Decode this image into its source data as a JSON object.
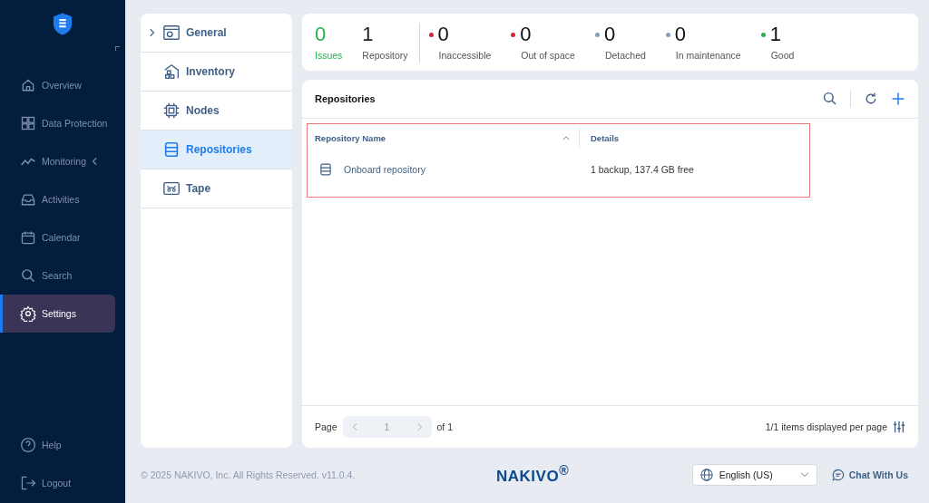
{
  "sidebar": {
    "items": [
      {
        "label": "Overview",
        "selected": false,
        "expandable": false
      },
      {
        "label": "Data Protection",
        "selected": false,
        "expandable": false
      },
      {
        "label": "Monitoring",
        "selected": false,
        "expandable": true
      },
      {
        "label": "Activities",
        "selected": false,
        "expandable": false
      },
      {
        "label": "Calendar",
        "selected": false,
        "expandable": false
      },
      {
        "label": "Search",
        "selected": false,
        "expandable": false
      },
      {
        "label": "Settings",
        "selected": true,
        "expandable": false
      }
    ],
    "bottom_items": [
      {
        "label": "Help"
      },
      {
        "label": "Logout"
      }
    ]
  },
  "settings_menu": [
    {
      "label": "General",
      "selected": false,
      "expandable": true
    },
    {
      "label": "Inventory",
      "selected": false,
      "expandable": false
    },
    {
      "label": "Nodes",
      "selected": false,
      "expandable": false
    },
    {
      "label": "Repositories",
      "selected": true,
      "expandable": false
    },
    {
      "label": "Tape",
      "selected": false,
      "expandable": false
    }
  ],
  "summary": [
    {
      "kind": "total",
      "value": "0",
      "label": "Issues",
      "color": "#22b14c"
    },
    {
      "kind": "total",
      "value": "1",
      "label": "Repository",
      "color": "#222222"
    },
    {
      "kind": "status",
      "value": "0",
      "label": "Inaccessible",
      "color": "#d9232e"
    },
    {
      "kind": "status",
      "value": "0",
      "label": "Out of space",
      "color": "#d9232e"
    },
    {
      "kind": "status",
      "value": "0",
      "label": "Detached",
      "color": "#8a9bb8"
    },
    {
      "kind": "status",
      "value": "0",
      "label": "In maintenance",
      "color": "#8a9bb8"
    },
    {
      "kind": "status",
      "value": "1",
      "label": "Good",
      "color": "#22b14c"
    }
  ],
  "repositories": {
    "title": "Repositories",
    "columns": [
      "Repository Name",
      "Details"
    ],
    "rows": [
      {
        "name": "Onboard repository",
        "details": "1 backup, 137.4 GB free"
      }
    ],
    "highlighted": true,
    "pagination": {
      "label": "Page",
      "page": "1",
      "of": "of 1",
      "summary": "1/1 items displayed per page"
    }
  },
  "footer": {
    "copyright": "© 2025 NAKIVO, Inc. All Rights Reserved. v11.0.4.",
    "logo": "NAKIVO$^{®}$",
    "language": "English (US)",
    "chat": "Chat With Us"
  }
}
